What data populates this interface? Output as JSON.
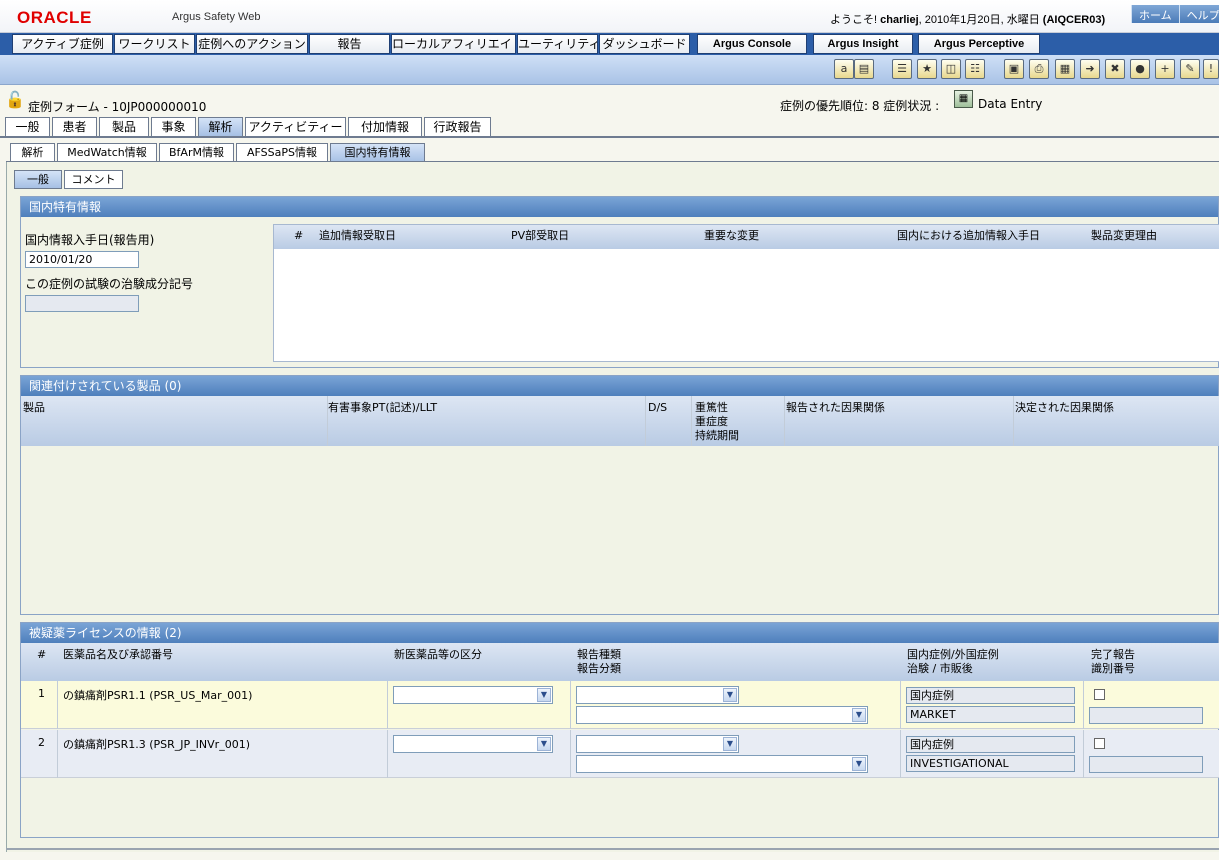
{
  "header": {
    "logo": "ORACLE",
    "app_name": "Argus Safety Web",
    "welcome_prefix": "ようこそ!",
    "user": "charliej",
    "date": ", 2010年1月20日, 水曜日",
    "enterprise": "(AIQCER03)",
    "links": [
      "ホーム",
      "ヘルプ"
    ]
  },
  "menu": {
    "items": [
      "アクティブ症例",
      "ワークリスト",
      "症例へのアクション",
      "報告",
      "ローカルアフィリエイト",
      "ユーティリティ",
      "ダッシュボード"
    ],
    "apps": [
      "Argus Console",
      "Argus Insight",
      "Argus Perceptive"
    ]
  },
  "toolbar": {
    "icons": [
      "spell-check-icon",
      "print-preview-icon",
      "notes-icon",
      "new-case-icon",
      "open-case-icon",
      "list-icon",
      "lock-case-icon",
      "print-icon",
      "save-icon",
      "route-icon",
      "close-case-icon",
      "stop-icon",
      "add-icon",
      "narrative-icon",
      "expedite-icon"
    ]
  },
  "case": {
    "title": "症例フォーム - 10JP000000010",
    "priority": "症例の優先順位: 8 症例状況 :",
    "status": "Data Entry"
  },
  "tabs": {
    "main": [
      {
        "label": "一般",
        "active": false
      },
      {
        "label": "患者",
        "active": false
      },
      {
        "label": "製品",
        "active": false
      },
      {
        "label": "事象",
        "active": false
      },
      {
        "label": "解析",
        "active": true
      },
      {
        "label": "アクティビティー",
        "active": false
      },
      {
        "label": "付加情報",
        "active": false
      },
      {
        "label": "行政報告",
        "active": false
      }
    ],
    "sub": [
      {
        "label": "解析",
        "active": false
      },
      {
        "label": "MedWatch情報",
        "active": false
      },
      {
        "label": "BfArM情報",
        "active": false
      },
      {
        "label": "AFSSaPS情報",
        "active": false
      },
      {
        "label": "国内特有情報",
        "active": true
      }
    ],
    "inner": [
      {
        "label": "一般",
        "active": true
      },
      {
        "label": "コメント",
        "active": false
      }
    ]
  },
  "jp_info": {
    "title": "国内特有情報",
    "recv_date_label": "国内情報入手日(報告用)",
    "recv_date_value": "2010/01/20",
    "trial_label": "この症例の試験の治験成分記号",
    "trial_value": "",
    "columns": [
      "#",
      "追加情報受取日",
      "PV部受取日",
      "重要な変更",
      "国内における追加情報入手日",
      "製品変更理由"
    ]
  },
  "related_products": {
    "title": "関連付けされている製品 (0)",
    "columns": [
      "製品",
      "有害事象PT(記述)/LLT",
      "D/S",
      "重篤性",
      "重症度",
      "持続期間",
      "報告された因果関係",
      "決定された因果関係"
    ]
  },
  "licenses": {
    "title": "被疑薬ライセンスの情報 (2)",
    "columns": {
      "num": "#",
      "name": "医薬品名及び承認番号",
      "new_drug": "新医薬品等の区分",
      "report_type": "報告種類",
      "report_class": "報告分類",
      "domestic": "国内症例/外国症例",
      "trial": "治験 / 市販後",
      "done": "完了報告",
      "id": "識別番号"
    },
    "rows": [
      {
        "num": "1",
        "name": "の鎮痛剤PSR1.1 (PSR_US_Mar_001)",
        "domestic": "国内症例",
        "trial": "MARKET"
      },
      {
        "num": "2",
        "name": "の鎮痛剤PSR1.3 (PSR_JP_INVr_001)",
        "domestic": "国内症例",
        "trial": "INVESTIGATIONAL"
      }
    ]
  },
  "colors": {
    "menu_bg": "#2c5ea8",
    "section_header": "#4e7fbc",
    "row1_bg": "#fbfbdc",
    "row2_bg": "#e8ecf4",
    "logo_red": "#e00000"
  }
}
